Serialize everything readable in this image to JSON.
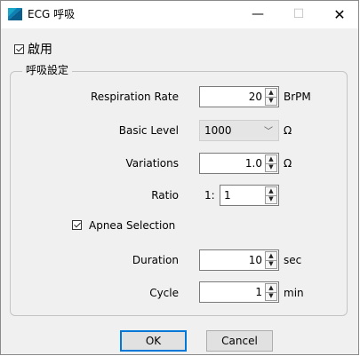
{
  "window": {
    "title": "ECG 呼吸",
    "minimize": "—",
    "maximize": "☐",
    "close": "✕"
  },
  "enable": {
    "label": "啟用",
    "checked": true
  },
  "group": {
    "legend": "呼吸設定"
  },
  "fields": {
    "respiration_rate": {
      "label": "Respiration Rate",
      "value": "20",
      "unit": "BrPM"
    },
    "basic_level": {
      "label": "Basic Level",
      "value": "1000",
      "unit": "Ω"
    },
    "variations": {
      "label": "Variations",
      "value": "1.0",
      "unit": "Ω"
    },
    "ratio": {
      "label": "Ratio",
      "prefix": "1:",
      "value": "1"
    },
    "apnea": {
      "label": "Apnea Selection",
      "checked": true
    },
    "duration": {
      "label": "Duration",
      "value": "10",
      "unit": "sec"
    },
    "cycle": {
      "label": "Cycle",
      "value": "1",
      "unit": "min"
    }
  },
  "buttons": {
    "ok": "OK",
    "cancel": "Cancel"
  },
  "icons": {
    "up": "▲",
    "down": "▼",
    "chevron": "﹀"
  }
}
